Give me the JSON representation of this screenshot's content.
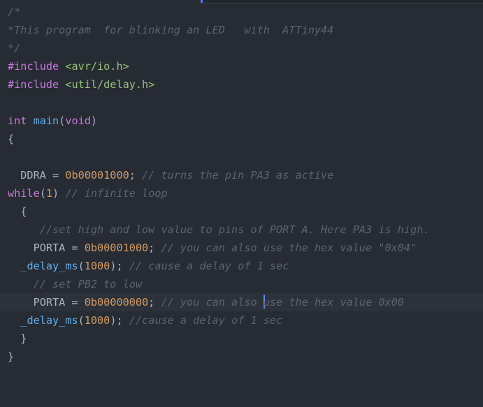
{
  "editor": {
    "lines": [
      {
        "parts": [
          {
            "t": "/*",
            "c": "comment"
          }
        ]
      },
      {
        "parts": [
          {
            "t": "*This program  for blinking an LED   with  ATTiny44",
            "c": "comment"
          }
        ]
      },
      {
        "parts": [
          {
            "t": "*/",
            "c": "comment"
          }
        ]
      },
      {
        "parts": [
          {
            "t": "#include ",
            "c": "keyword"
          },
          {
            "t": "<avr/io.h>",
            "c": "include-target"
          }
        ]
      },
      {
        "parts": [
          {
            "t": "#include ",
            "c": "keyword"
          },
          {
            "t": "<util/delay.h>",
            "c": "include-target"
          }
        ]
      },
      {
        "parts": []
      },
      {
        "parts": [
          {
            "t": "int ",
            "c": "keyword"
          },
          {
            "t": "main",
            "c": "fn"
          },
          {
            "t": "(",
            "c": "plain"
          },
          {
            "t": "void",
            "c": "keyword"
          },
          {
            "t": ")",
            "c": "plain"
          }
        ]
      },
      {
        "parts": [
          {
            "t": "{",
            "c": "plain"
          }
        ]
      },
      {
        "parts": []
      },
      {
        "parts": [
          {
            "t": "  DDRA = ",
            "c": "plain"
          },
          {
            "t": "0b00001000",
            "c": "number"
          },
          {
            "t": "; ",
            "c": "plain"
          },
          {
            "t": "// turns the pin PA3 as active",
            "c": "comment"
          }
        ]
      },
      {
        "parts": [
          {
            "t": "while",
            "c": "keyword"
          },
          {
            "t": "(",
            "c": "plain"
          },
          {
            "t": "1",
            "c": "number"
          },
          {
            "t": ") ",
            "c": "plain"
          },
          {
            "t": "// infinite loop",
            "c": "comment"
          }
        ]
      },
      {
        "parts": [
          {
            "t": "  {",
            "c": "plain"
          }
        ]
      },
      {
        "parts": [
          {
            "t": "     ",
            "c": "plain"
          },
          {
            "t": "//set high and low value to pins of PORT A. Here PA3 is high.",
            "c": "comment"
          }
        ]
      },
      {
        "parts": [
          {
            "t": "    PORTA = ",
            "c": "plain"
          },
          {
            "t": "0b00001000",
            "c": "number"
          },
          {
            "t": "; ",
            "c": "plain"
          },
          {
            "t": "// you can also use the hex value \"0x04\"",
            "c": "comment"
          }
        ]
      },
      {
        "parts": [
          {
            "t": "  ",
            "c": "plain"
          },
          {
            "t": "_delay_ms",
            "c": "fn"
          },
          {
            "t": "(",
            "c": "plain"
          },
          {
            "t": "1000",
            "c": "number"
          },
          {
            "t": "); ",
            "c": "plain"
          },
          {
            "t": "// cause a delay of 1 sec",
            "c": "comment"
          }
        ]
      },
      {
        "parts": [
          {
            "t": "    ",
            "c": "plain"
          },
          {
            "t": "// set PB2 to low",
            "c": "comment"
          }
        ]
      },
      {
        "parts": [
          {
            "t": "    PORTA = ",
            "c": "plain"
          },
          {
            "t": "0b00000000",
            "c": "number"
          },
          {
            "t": "; ",
            "c": "plain"
          },
          {
            "t": "// you can also ",
            "c": "comment"
          },
          {
            "cursor": true
          },
          {
            "t": "use the hex value 0x00",
            "c": "comment"
          }
        ]
      },
      {
        "parts": [
          {
            "t": "  ",
            "c": "plain"
          },
          {
            "t": "_delay_ms",
            "c": "fn"
          },
          {
            "t": "(",
            "c": "plain"
          },
          {
            "t": "1000",
            "c": "number"
          },
          {
            "t": "); ",
            "c": "plain"
          },
          {
            "t": "//cause a delay of 1 sec",
            "c": "comment"
          }
        ]
      },
      {
        "parts": [
          {
            "t": "  }",
            "c": "plain"
          }
        ]
      },
      {
        "parts": [
          {
            "t": "}",
            "c": "plain"
          }
        ]
      }
    ]
  }
}
